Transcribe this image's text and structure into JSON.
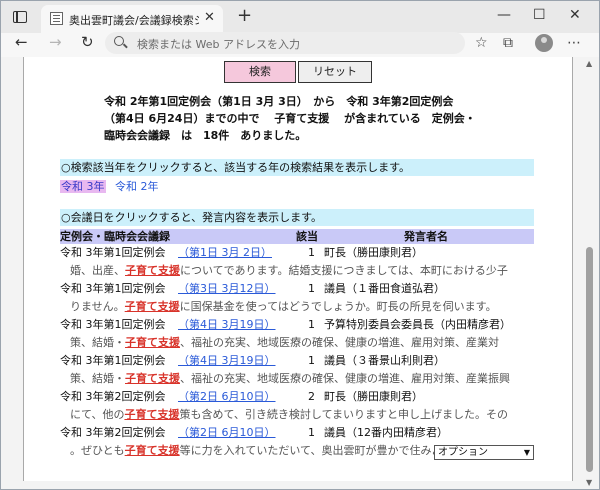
{
  "browser": {
    "tab_title": "奥出雲町議会/会議録検索システム",
    "tab_close": "✕",
    "new_tab": "+",
    "address_placeholder": "検索または Web アドレスを入力",
    "win_minimize": "—",
    "win_maximize": "☐",
    "win_close": "✕"
  },
  "search": {
    "search_label": "検索",
    "reset_label": "リセット"
  },
  "summary": {
    "line1": "令和 2年第1回定例会（第1日 3月 3日）　から　令和 3年第2回定例会",
    "line2": "（第4日 6月24日）までの中で　 子育て支援　 が含まれている　定例会・",
    "line3": "臨時会会議録　は　18件　ありました。"
  },
  "year_info": "○検索該当年をクリックすると、該当する年の検索結果を表示します。",
  "years": [
    "令和 3年",
    "令和 2年"
  ],
  "meeting_info": "○会議日をクリックすると、発言内容を表示します。",
  "table": {
    "headers": [
      "定例会・臨時会会議録",
      "該当",
      "発言者名"
    ],
    "keyword": "子育て支援",
    "rows": [
      {
        "meeting": "令和 3年第1回定例会",
        "date": "（第1日 3月 2日）",
        "count": "1",
        "speaker": "町長（勝田康則君）",
        "pre": "婚、出産、",
        "post": "についてであります。結婚支援につきましては、本町における少子"
      },
      {
        "meeting": "令和 3年第1回定例会",
        "date": "（第3日 3月12日）",
        "count": "1",
        "speaker": "議員（１番田食道弘君）",
        "pre": "りません。",
        "post": "に国保基金を使ってはどうでしょうか。町長の所見を伺います。"
      },
      {
        "meeting": "令和 3年第1回定例会",
        "date": "（第4日 3月19日）",
        "count": "1",
        "speaker": "予算特別委員会委員長（内田精彦君）",
        "pre": "策、結婚・",
        "post": "、福祉の充実、地域医療の確保、健康の増進、雇用対策、産業対"
      },
      {
        "meeting": "令和 3年第1回定例会",
        "date": "（第4日 3月19日）",
        "count": "1",
        "speaker": "議員（３番景山利則君）",
        "pre": "策、結婚・",
        "post": "、福祉の充実、地域医療の確保、健康の増進、雇用対策、産業振興"
      },
      {
        "meeting": "令和 3年第2回定例会",
        "date": "（第2日 6月10日）",
        "count": "2",
        "speaker": "町長（勝田康則君）",
        "pre": "にて、他の",
        "post": "策も含めて、引き続き検討してまいりますと申し上げました。その"
      },
      {
        "meeting": "令和 3年第2回定例会",
        "date": "（第2日 6月10日）",
        "count": "1",
        "speaker": "議員（12番内田精彦君）",
        "pre": "。ぜひとも",
        "post": "等に力を入れていただいて、奥出雲町が豊かで住みよい町になりま"
      }
    ]
  },
  "option_select": "オプション"
}
